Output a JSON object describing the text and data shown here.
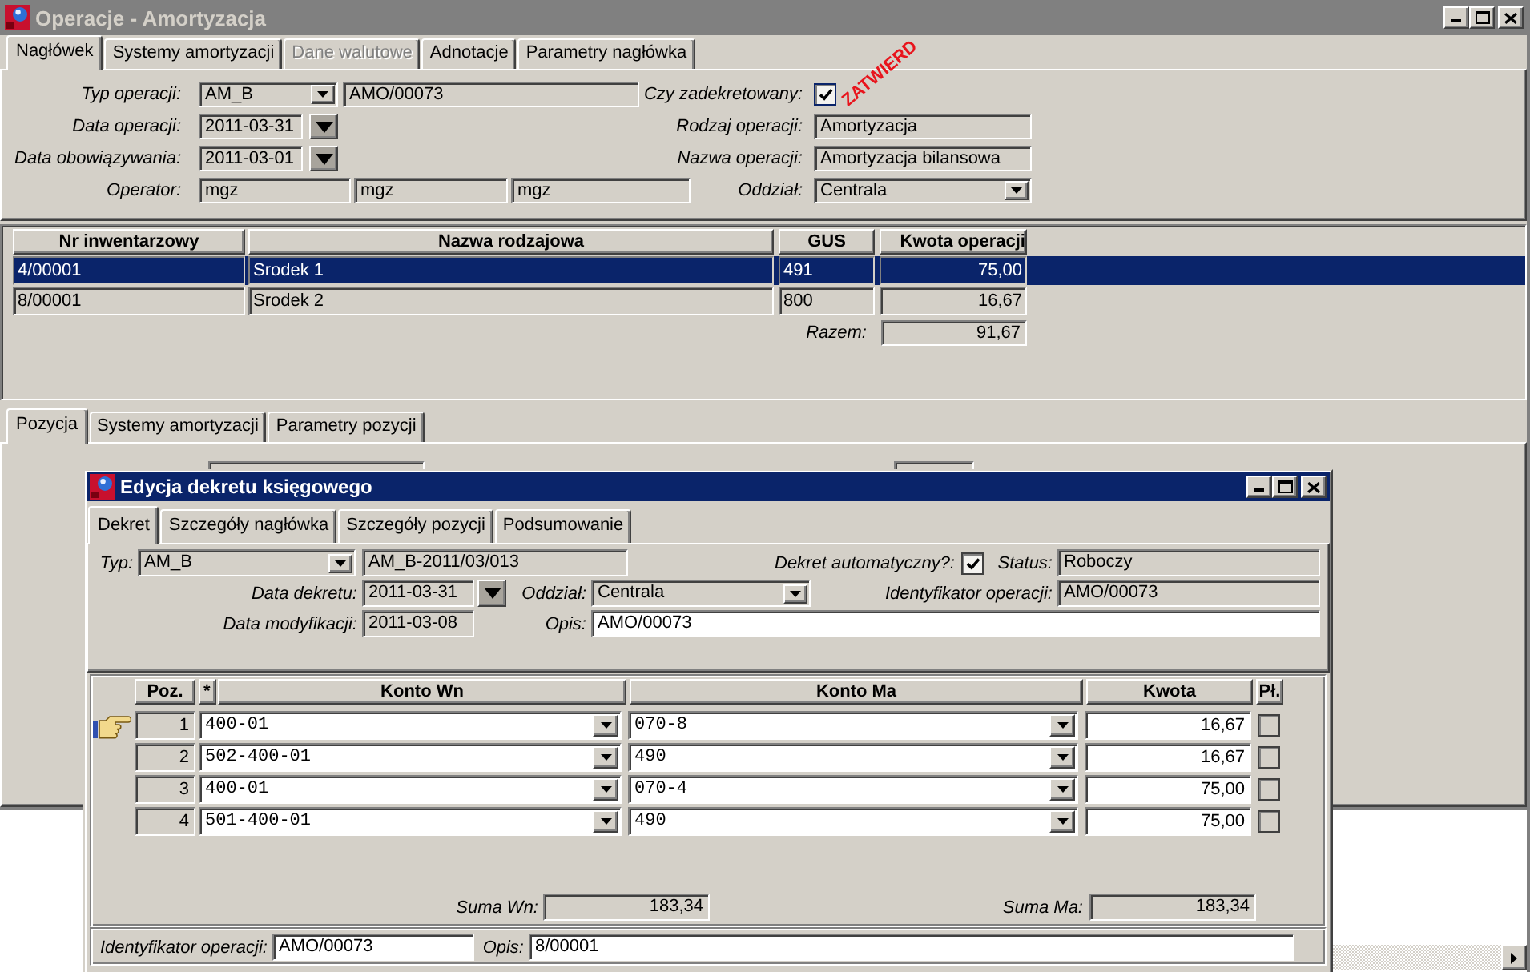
{
  "window": {
    "title": "Operacje - Amortyzacja"
  },
  "tabs": [
    {
      "label": "Nagłówek",
      "selected": true,
      "disabled": false
    },
    {
      "label": "Systemy amortyzacji",
      "selected": false,
      "disabled": false
    },
    {
      "label": "Dane walutowe",
      "selected": false,
      "disabled": true
    },
    {
      "label": "Adnotacje",
      "selected": false,
      "disabled": false
    },
    {
      "label": "Parametry nagłówka",
      "selected": false,
      "disabled": false
    }
  ],
  "header": {
    "operation_type": {
      "label": "Typ operacji:",
      "value": "AM_B"
    },
    "document_number": {
      "value": "AMO/00073"
    },
    "posted": {
      "label": "Czy zadekretowany:",
      "checked": true
    },
    "operation_date": {
      "label": "Data operacji:",
      "value": "2011-03-31"
    },
    "operation_kind": {
      "label": "Rodzaj operacji:",
      "value": "Amortyzacja"
    },
    "validity_date": {
      "label": "Data obowiązywania:",
      "value": "2011-03-01"
    },
    "operation_name": {
      "label": "Nazwa operacji:",
      "value": "Amortyzacja bilansowa"
    },
    "operator": {
      "label": "Operator:",
      "values": [
        "mgz",
        "mgz",
        "mgz"
      ]
    },
    "branch": {
      "label": "Oddział:",
      "value": "Centrala"
    },
    "stamp": "ZATWIERD"
  },
  "assets_table": {
    "columns": [
      "Nr inwentarzowy",
      "Nazwa rodzajowa",
      "GUS",
      "Kwota operacji"
    ],
    "rows": [
      {
        "cells": [
          "4/00001",
          "Srodek 1",
          "491",
          "75,00"
        ],
        "selected": true
      },
      {
        "cells": [
          "8/00001",
          "Srodek 2",
          "800",
          "16,67"
        ],
        "selected": false
      }
    ],
    "total_label": "Razem:",
    "total": "91,67"
  },
  "position_tabs": [
    {
      "label": "Pozycja",
      "selected": true
    },
    {
      "label": "Systemy amortyzacji",
      "selected": false
    },
    {
      "label": "Parametry pozycji",
      "selected": false
    }
  ],
  "dialog": {
    "title": "Edycja dekretu księgowego",
    "tabs": [
      {
        "label": "Dekret",
        "selected": true
      },
      {
        "label": "Szczegóły nagłówka",
        "selected": false
      },
      {
        "label": "Szczegóły pozycji",
        "selected": false
      },
      {
        "label": "Podsumowanie",
        "selected": false
      }
    ],
    "type": {
      "label": "Typ:",
      "value": "AM_B",
      "editable": false
    },
    "number": {
      "value": "AM_B-2011/03/013",
      "editable": false
    },
    "auto": {
      "label": "Dekret automatyczny?:",
      "checked": true
    },
    "status": {
      "label": "Status:",
      "value": "Roboczy",
      "editable": false
    },
    "entry_date": {
      "label": "Data dekretu:",
      "value": "2011-03-31",
      "editable": false
    },
    "branch": {
      "label": "Oddział:",
      "value": "Centrala",
      "editable": false
    },
    "operation_id": {
      "label": "Identyfikator operacji:",
      "value": "AMO/00073",
      "editable": false
    },
    "modified_date": {
      "label": "Data modyfikacji:",
      "value": "2011-03-08",
      "editable": false
    },
    "description": {
      "label": "Opis:",
      "value": "AMO/00073",
      "editable": true
    },
    "grid": {
      "columns": [
        "Poz.",
        "*",
        "Konto Wn",
        "Konto Ma",
        "Kwota",
        "Pł."
      ],
      "rows": [
        {
          "number": "1",
          "debit": "400-01",
          "credit": "070-8",
          "amount": "16,67",
          "paid": false,
          "current": true
        },
        {
          "number": "2",
          "debit": "502-400-01",
          "credit": "490",
          "amount": "16,67",
          "paid": false,
          "current": false
        },
        {
          "number": "3",
          "debit": "400-01",
          "credit": "070-4",
          "amount": "75,00",
          "paid": false,
          "current": false
        },
        {
          "number": "4",
          "debit": "501-400-01",
          "credit": "490",
          "amount": "75,00",
          "paid": false,
          "current": false
        }
      ]
    },
    "debit_total": {
      "label": "Suma Wn:",
      "value": "183,34"
    },
    "credit_total": {
      "label": "Suma Ma:",
      "value": "183,34"
    },
    "footer_id": {
      "label": "Identyfikator operacji:",
      "value": "AMO/00073",
      "editable": true
    },
    "footer_description": {
      "label": "Opis:",
      "value": "8/00001",
      "editable": true
    }
  }
}
